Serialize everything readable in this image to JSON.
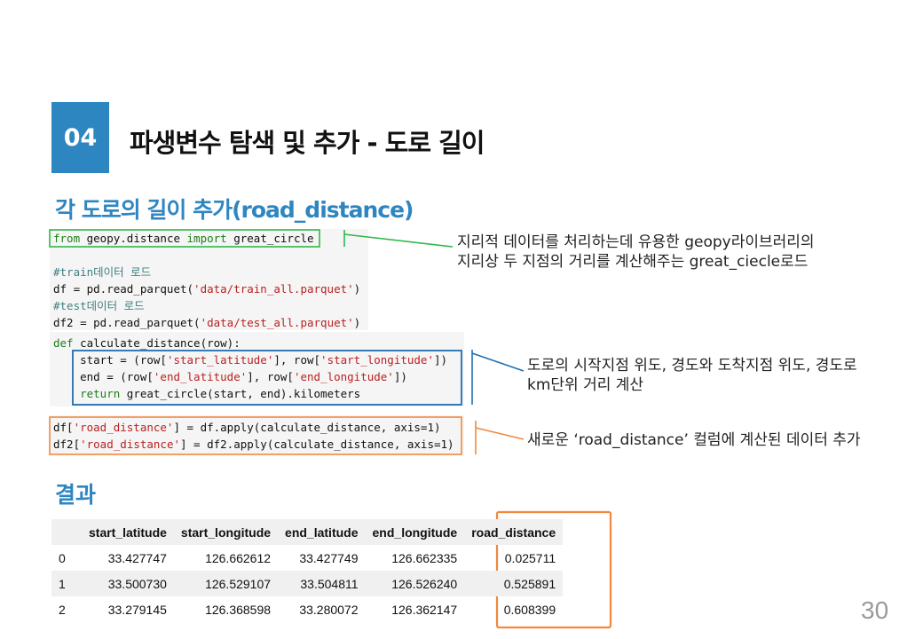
{
  "slide": {
    "section_number": "04",
    "title": "파생변수 탐색 및 추가 - 도로 길이",
    "subtitle": "각 도로의 길이 추가(road_distance)",
    "page_number": "30",
    "accent_color": "#2e86c1"
  },
  "code": {
    "import_line": {
      "kw1": "from",
      "mod": " geopy.distance ",
      "kw2": "import",
      "name": " great_circle"
    },
    "train_comment": "#train데이터 로드",
    "train_line": {
      "pre": "df = pd.read_parquet(",
      "str": "'data/train_all.parquet'",
      "post": ")"
    },
    "test_comment": "#test데이터 로드",
    "test_line": {
      "pre": "df2 = pd.read_parquet(",
      "str": "'data/test_all.parquet'",
      "post": ")"
    },
    "def_line": {
      "kw": "def",
      "rest": " calculate_distance(row):"
    },
    "start_line": {
      "a": "    start = (row[",
      "s1": "'start_latitude'",
      "b": "], row[",
      "s2": "'start_longitude'",
      "c": "])"
    },
    "end_line": {
      "a": "    end = (row[",
      "s1": "'end_latitude'",
      "b": "], row[",
      "s2": "'end_longitude'",
      "c": "])"
    },
    "return_line": {
      "kw": "    return",
      "rest": " great_circle(start, end).kilometers"
    },
    "apply1": {
      "a": "df[",
      "s": "'road_distance'",
      "b": "] = df.apply(calculate_distance, axis=1)"
    },
    "apply2": {
      "a": "df2[",
      "s": "'road_distance'",
      "b": "] = df2.apply(calculate_distance, axis=1)"
    }
  },
  "annotations": {
    "green": {
      "line1": "지리적 데이터를 처리하는데 유용한 geopy라이브러리의",
      "line2": "지리상 두 지점의 거리를 계산해주는 great_ciecle로드",
      "color": "#2eb84a"
    },
    "blue": {
      "line1": "도로의 시작지점 위도, 경도와 도착지점 위도, 경도로",
      "line2": "km단위 거리 계산",
      "color": "#1f6fb2"
    },
    "orange": {
      "line1": "새로운 ‘road_distance’ 컬럼에 계산된 데이터 추가",
      "color": "#f0883e"
    }
  },
  "result": {
    "title": "결과",
    "columns": [
      "",
      "start_latitude",
      "start_longitude",
      "end_latitude",
      "end_longitude",
      "road_distance"
    ],
    "rows": [
      [
        "0",
        "33.427747",
        "126.662612",
        "33.427749",
        "126.662335",
        "0.025711"
      ],
      [
        "1",
        "33.500730",
        "126.529107",
        "33.504811",
        "126.526240",
        "0.525891"
      ],
      [
        "2",
        "33.279145",
        "126.368598",
        "33.280072",
        "126.362147",
        "0.608399"
      ]
    ],
    "highlight_color": "#f0883e"
  }
}
